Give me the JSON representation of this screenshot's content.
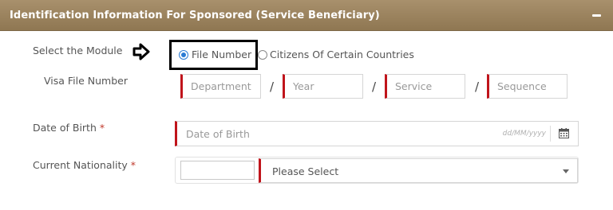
{
  "panel": {
    "title": "Identification Information For Sponsored (Service Beneficiary)",
    "collapse_icon": "minus-icon"
  },
  "module": {
    "label": "Select the Module",
    "options": [
      {
        "label": "File Number",
        "selected": true
      },
      {
        "label": "Citizens Of Certain Countries",
        "selected": false
      }
    ]
  },
  "visa": {
    "label": "Visa File Number",
    "fields": [
      {
        "placeholder": "Department"
      },
      {
        "placeholder": "Year"
      },
      {
        "placeholder": "Service"
      },
      {
        "placeholder": "Sequence"
      }
    ],
    "separator": "/"
  },
  "dob": {
    "label": "Date of Birth",
    "required_mark": "*",
    "placeholder": "Date of Birth",
    "format_hint": "dd/MM/yyyy",
    "icon": "calendar-icon"
  },
  "nationality": {
    "label": "Current Nationality",
    "required_mark": "*",
    "selected": "Please Select"
  },
  "colors": {
    "header": "#9a8260",
    "accent_required": "#c0141b",
    "radio_selected": "#2a7bd4"
  }
}
